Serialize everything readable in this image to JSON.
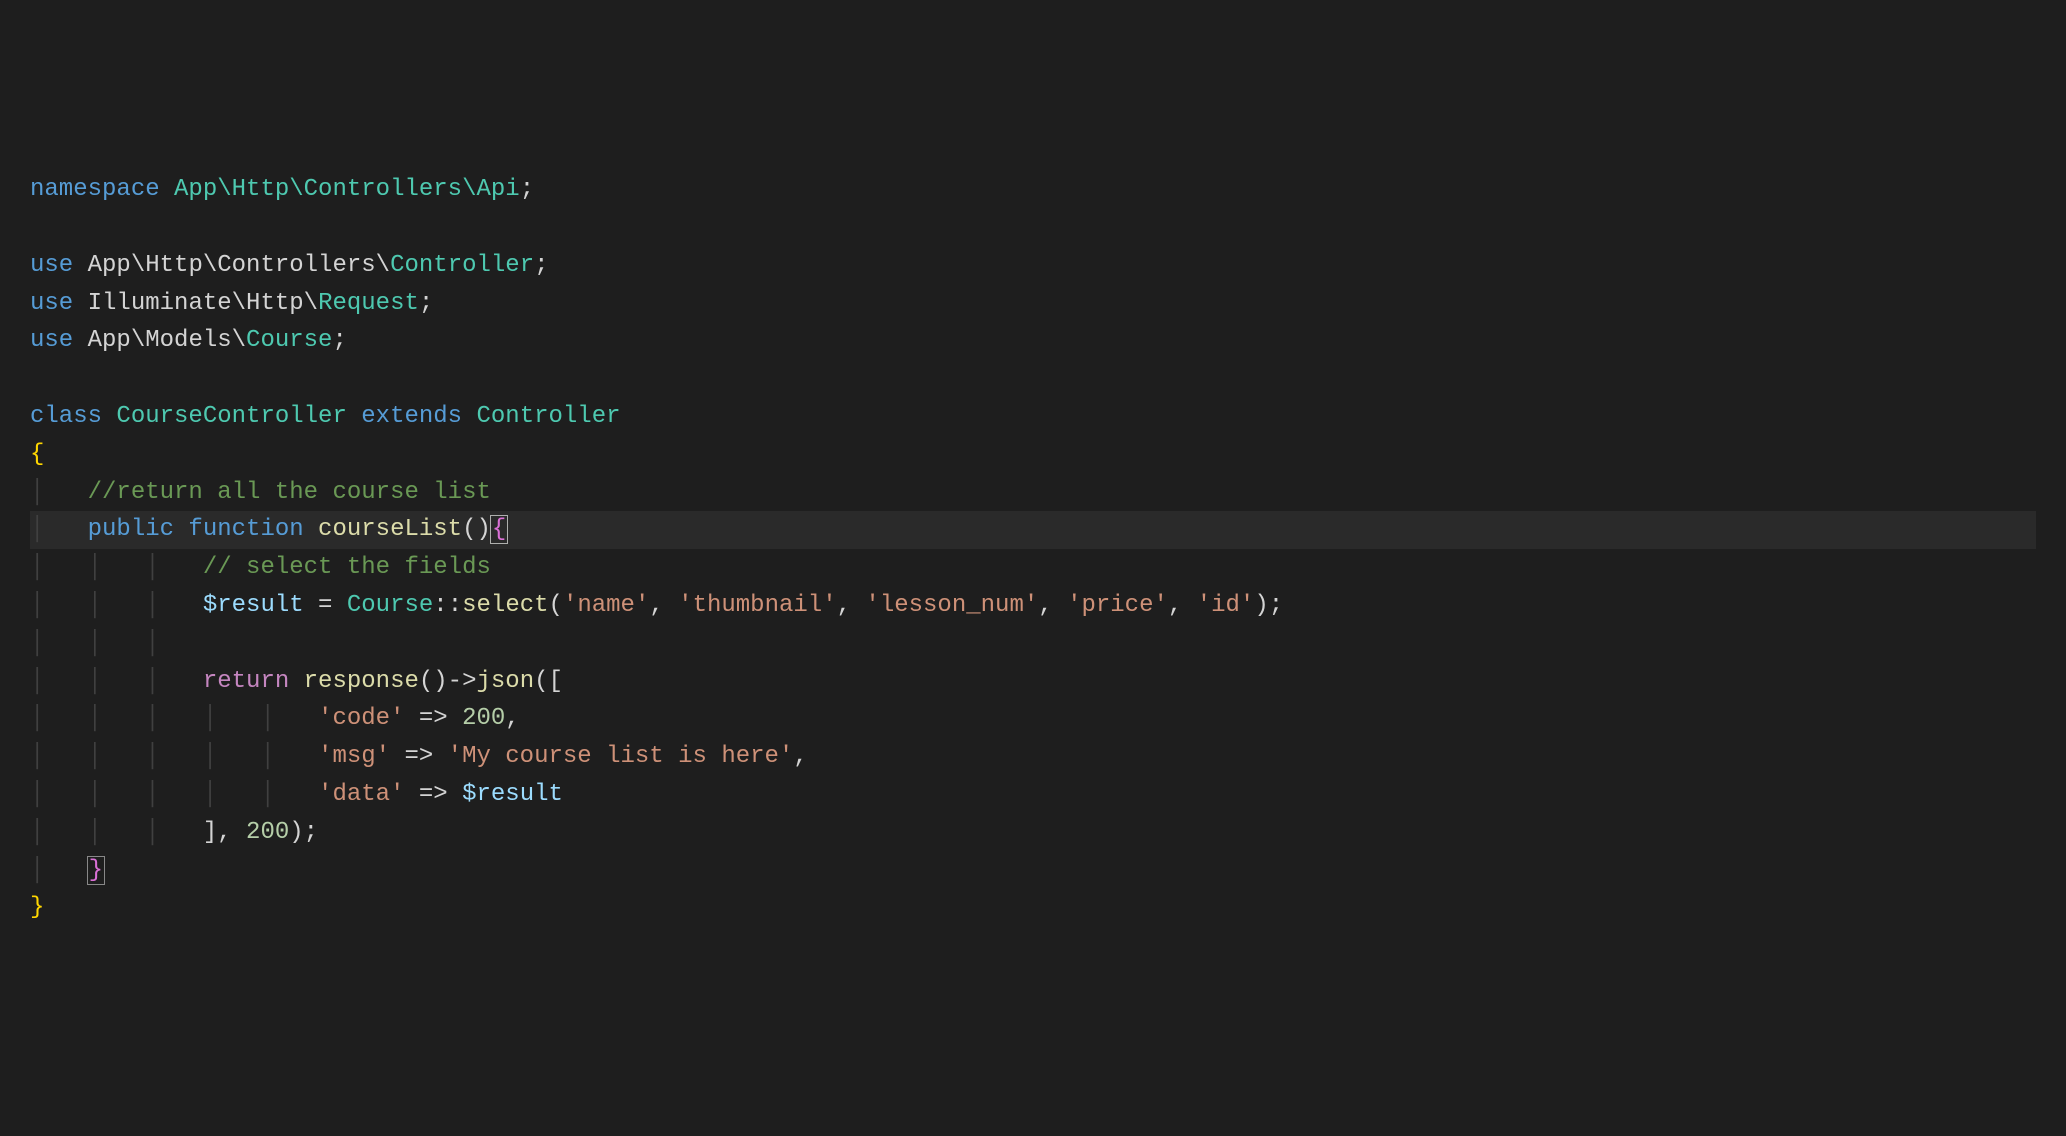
{
  "code": {
    "l1_ns": "namespace",
    "l1_nspath": " App\\Http\\Controllers\\Api",
    "l1_semi": ";",
    "l3_use": "use",
    "l3_path": " App\\Http\\Controllers\\",
    "l3_cls": "Controller",
    "l3_semi": ";",
    "l4_use": "use",
    "l4_path": " Illuminate\\Http\\",
    "l4_cls": "Request",
    "l4_semi": ";",
    "l5_use": "use",
    "l5_path": " App\\Models\\",
    "l5_cls": "Course",
    "l5_semi": ";",
    "l7_class": "class",
    "l7_name": " CourseController",
    "l7_ext": " extends",
    "l7_base": " Controller",
    "l8_ob": "{",
    "l9_cmt": "//return all the course list",
    "l10_pub": "public",
    "l10_func": " function",
    "l10_name": " courseList",
    "l10_paren": "()",
    "l10_ob": "{",
    "l11_cmt": "// select the fields",
    "l12_var": "$result",
    "l12_eq": " = ",
    "l12_cls": "Course",
    "l12_sr": "::",
    "l12_fn": "select",
    "l12_op": "(",
    "l12_s1": "'name'",
    "l12_c1": ", ",
    "l12_s2": "'thumbnail'",
    "l12_c2": ", ",
    "l12_s3": "'lesson_num'",
    "l12_c3": ", ",
    "l12_s4": "'price'",
    "l12_c4": ", ",
    "l12_s5": "'id'",
    "l12_cp": ");",
    "l14_ret": "return",
    "l14_sp": " ",
    "l14_fn1": "response",
    "l14_p1": "()->",
    "l14_fn2": "json",
    "l14_p2": "([",
    "l15_k": "'code'",
    "l15_ar": " => ",
    "l15_v": "200",
    "l15_c": ",",
    "l16_k": "'msg'",
    "l16_ar": " => ",
    "l16_v": "'My course list is here'",
    "l16_c": ",",
    "l17_k": "'data'",
    "l17_ar": " => ",
    "l17_v": "$result",
    "l18_cl": "], ",
    "l18_n": "200",
    "l18_cp": ");",
    "l19_cb": "}",
    "l20_cb": "}"
  }
}
